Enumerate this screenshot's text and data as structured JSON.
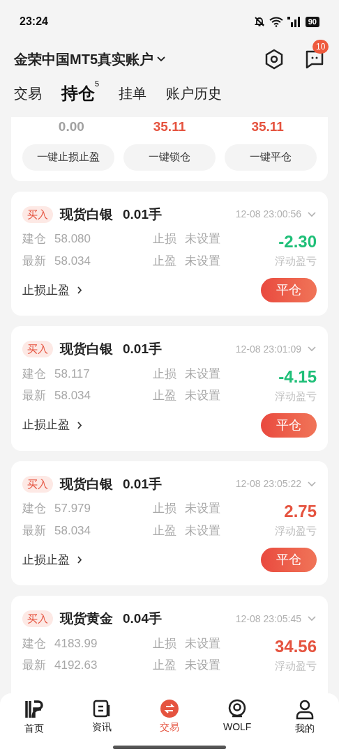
{
  "status_bar": {
    "time": "23:24",
    "battery": "90"
  },
  "header": {
    "account": "金荣中国MT5真实账户",
    "message_badge": "10"
  },
  "tabs": [
    {
      "label": "交易",
      "selected": false
    },
    {
      "label": "持仓",
      "selected": true,
      "count": "5"
    },
    {
      "label": "挂单",
      "selected": false
    },
    {
      "label": "账户历史",
      "selected": false
    }
  ],
  "summary": {
    "values": [
      {
        "text": "0.00",
        "color": "#a0a0a0"
      },
      {
        "text": "35.11",
        "color": "#e5533f"
      },
      {
        "text": "35.11",
        "color": "#e5533f"
      }
    ],
    "actions": [
      "一键止损止盈",
      "一键锁仓",
      "一键平仓"
    ]
  },
  "positions": [
    {
      "side": "买入",
      "symbol": "现货白银",
      "lots": "0.01手",
      "time": "12-08 23:00:56",
      "open_label": "建仓",
      "open": "58.080",
      "last_label": "最新",
      "last": "58.034",
      "sl_label": "止损",
      "sl": "未设置",
      "tp_label": "止盈",
      "tp": "未设置",
      "pnl": "-2.30",
      "color": "#1fbf78",
      "pnl_label": "浮动盈亏",
      "sltp_link": "止损止盈",
      "close": "平仓"
    },
    {
      "side": "买入",
      "symbol": "现货白银",
      "lots": "0.01手",
      "time": "12-08 23:01:09",
      "open_label": "建仓",
      "open": "58.117",
      "last_label": "最新",
      "last": "58.034",
      "sl_label": "止损",
      "sl": "未设置",
      "tp_label": "止盈",
      "tp": "未设置",
      "pnl": "-4.15",
      "color": "#1fbf78",
      "pnl_label": "浮动盈亏",
      "sltp_link": "止损止盈",
      "close": "平仓"
    },
    {
      "side": "买入",
      "symbol": "现货白银",
      "lots": "0.01手",
      "time": "12-08 23:05:22",
      "open_label": "建仓",
      "open": "57.979",
      "last_label": "最新",
      "last": "58.034",
      "sl_label": "止损",
      "sl": "未设置",
      "tp_label": "止盈",
      "tp": "未设置",
      "pnl": "2.75",
      "color": "#e5533f",
      "pnl_label": "浮动盈亏",
      "sltp_link": "止损止盈",
      "close": "平仓"
    },
    {
      "side": "买入",
      "symbol": "现货黄金",
      "lots": "0.04手",
      "time": "12-08 23:05:45",
      "open_label": "建仓",
      "open": "4183.99",
      "last_label": "最新",
      "last": "4192.63",
      "sl_label": "止损",
      "sl": "未设置",
      "tp_label": "止盈",
      "tp": "未设置",
      "pnl": "34.56",
      "color": "#e5533f",
      "pnl_label": "浮动盈亏"
    }
  ],
  "bottom_nav": [
    {
      "label": "首页",
      "kind": "home",
      "selected": false
    },
    {
      "label": "资讯",
      "kind": "news",
      "selected": false
    },
    {
      "label": "交易",
      "kind": "trade",
      "selected": true
    },
    {
      "label": "WOLF",
      "kind": "wolf",
      "selected": false
    },
    {
      "label": "我的",
      "kind": "me",
      "selected": false
    }
  ]
}
